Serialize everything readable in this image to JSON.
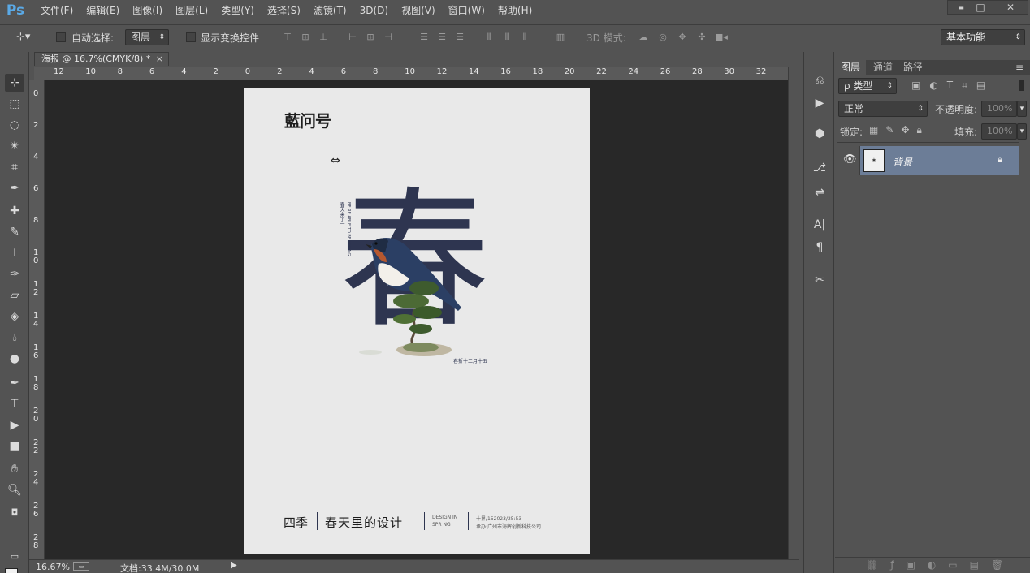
{
  "app": {
    "logo": "Ps"
  },
  "menu": [
    "文件(F)",
    "编辑(E)",
    "图像(I)",
    "图层(L)",
    "类型(Y)",
    "选择(S)",
    "滤镜(T)",
    "3D(D)",
    "视图(V)",
    "窗口(W)",
    "帮助(H)"
  ],
  "window_controls": {
    "minimize": "▬",
    "maximize": "□",
    "close": "✕"
  },
  "options": {
    "auto_select_label": "自动选择:",
    "auto_select_value": "图层",
    "show_transform_label": "显示变换控件",
    "mode_3d_label": "3D 模式:",
    "workspace": "基本功能"
  },
  "document": {
    "tab_title": "海报 @ 16.7%(CMYK/8) *",
    "close": "×"
  },
  "ruler": {
    "h_labels": [
      "12",
      "10",
      "8",
      "6",
      "4",
      "2",
      "0",
      "2",
      "4",
      "6",
      "8",
      "10",
      "12",
      "14",
      "16",
      "18",
      "20",
      "22",
      "24",
      "26",
      "28",
      "30",
      "32"
    ],
    "v_labels": [
      "0",
      "2",
      "4",
      "6",
      "8",
      "10",
      "12",
      "14",
      "16",
      "18",
      "20",
      "22",
      "24",
      "26",
      "28"
    ]
  },
  "poster": {
    "brand": "藍问号",
    "main_char": "春",
    "vertical_small_1": "春天来了一",
    "vertical_small_2": "BE RE ABLE TO BE SPRING",
    "date_caption": "春折十二月十五",
    "footer_left": "四季",
    "footer_mid": "春天里的设计",
    "footer_design": "DESIGN IN",
    "footer_spring": "SPR NG",
    "footer_num": "十界/152023/25:53",
    "footer_addr": "承办:广州市海辉创新科技公司"
  },
  "status": {
    "zoom": "16.67%",
    "doc": "文档:33.4M/30.0M"
  },
  "layers_panel": {
    "tabs": [
      "图层",
      "通道",
      "路径"
    ],
    "filter_kind": "ρ 类型",
    "blend_mode": "正常",
    "opacity_label": "不透明度:",
    "opacity_value": "100%",
    "lock_label": "锁定:",
    "fill_label": "填充:",
    "fill_value": "100%",
    "layer_name": "背景"
  },
  "colors": {
    "accent": "#5aa9e6",
    "layer_selected": "#6c7d97",
    "canvas_bg": "#282828",
    "ui_bg": "#535353",
    "poster_ink": "#2e3550"
  }
}
